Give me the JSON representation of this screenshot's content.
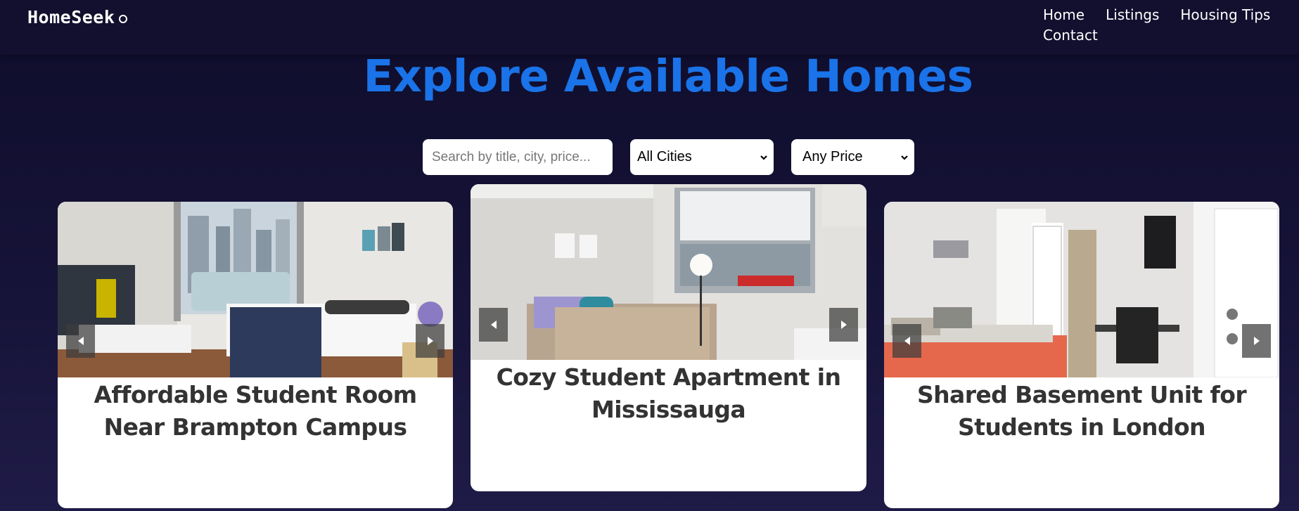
{
  "nav": {
    "logo": "HomeSeek",
    "links": [
      "Home",
      "Listings",
      "Housing Tips",
      "Contact"
    ]
  },
  "page": {
    "title": "Explore Available Homes"
  },
  "filters": {
    "search_placeholder": "Search by title, city, price...",
    "city_selected": "All Cities",
    "price_selected": "Any Price"
  },
  "listings": [
    {
      "title": "Affordable Student Room Near Brampton Campus"
    },
    {
      "title": "Cozy Student Apartment in Mississauga"
    },
    {
      "title": "Shared Basement Unit for Students in London"
    }
  ],
  "icons": {
    "prev": "chevron-left-icon",
    "next": "chevron-right-icon",
    "select": "chevron-down-icon",
    "logo": "ring-icon"
  },
  "colors": {
    "background": "#161338",
    "navbar": "#12102e",
    "title": "#1a73e8",
    "card": "#ffffff",
    "card_text": "#333333"
  }
}
